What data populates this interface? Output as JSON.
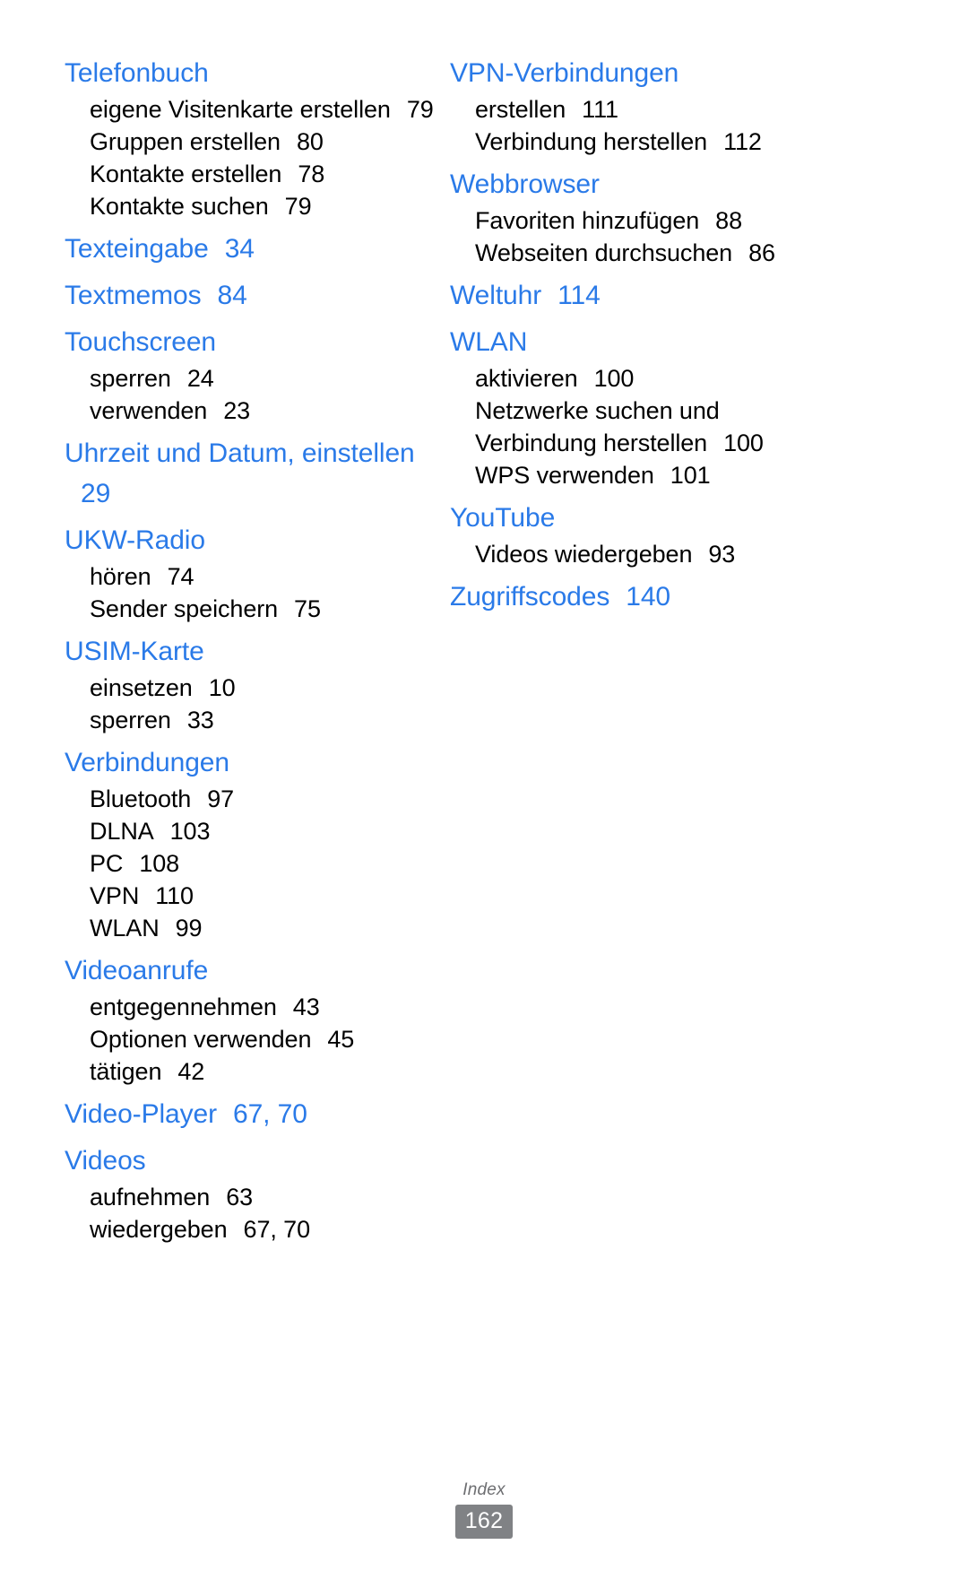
{
  "document": {
    "language": "de",
    "footer_label": "Index",
    "page_number": "162",
    "heading_color": "#2a7ae8",
    "body_color": "#000000",
    "badge_color": "#808285",
    "badge_text_color": "#ffffff"
  },
  "columns": [
    {
      "id": "left",
      "groups": [
        {
          "heading": "Telefonbuch",
          "heading_page": "",
          "subs": [
            {
              "label": "eigene Visitenkarte erstellen",
              "page": "79"
            },
            {
              "label": "Gruppen erstellen",
              "page": "80"
            },
            {
              "label": "Kontakte erstellen",
              "page": "78"
            },
            {
              "label": "Kontakte suchen",
              "page": "79"
            }
          ]
        },
        {
          "heading": "Texteingabe",
          "heading_page": "34",
          "subs": []
        },
        {
          "heading": "Textmemos",
          "heading_page": "84",
          "subs": []
        },
        {
          "heading": "Touchscreen",
          "heading_page": "",
          "subs": [
            {
              "label": "sperren",
              "page": "24"
            },
            {
              "label": "verwenden",
              "page": "23"
            }
          ]
        },
        {
          "heading": "Uhrzeit und Datum, einstellen",
          "heading_page": "29",
          "subs": []
        },
        {
          "heading": "UKW-Radio",
          "heading_page": "",
          "subs": [
            {
              "label": "hören",
              "page": "74"
            },
            {
              "label": "Sender speichern",
              "page": "75"
            }
          ]
        },
        {
          "heading": "USIM-Karte",
          "heading_page": "",
          "subs": [
            {
              "label": "einsetzen",
              "page": "10"
            },
            {
              "label": "sperren",
              "page": "33"
            }
          ]
        },
        {
          "heading": "Verbindungen",
          "heading_page": "",
          "subs": [
            {
              "label": "Bluetooth",
              "page": "97"
            },
            {
              "label": "DLNA",
              "page": "103"
            },
            {
              "label": "PC",
              "page": "108"
            },
            {
              "label": "VPN",
              "page": "110"
            },
            {
              "label": "WLAN",
              "page": "99"
            }
          ]
        },
        {
          "heading": "Videoanrufe",
          "heading_page": "",
          "subs": [
            {
              "label": "entgegennehmen",
              "page": "43"
            },
            {
              "label": "Optionen verwenden",
              "page": "45"
            },
            {
              "label": "tätigen",
              "page": "42"
            }
          ]
        },
        {
          "heading": "Video-Player",
          "heading_page": "67, 70",
          "subs": []
        },
        {
          "heading": "Videos",
          "heading_page": "",
          "subs": [
            {
              "label": "aufnehmen",
              "page": "63"
            },
            {
              "label": "wiedergeben",
              "page": "67, 70"
            }
          ]
        }
      ]
    },
    {
      "id": "right",
      "groups": [
        {
          "heading": "VPN-Verbindungen",
          "heading_page": "",
          "subs": [
            {
              "label": "erstellen",
              "page": "111"
            },
            {
              "label": "Verbindung herstellen",
              "page": "112"
            }
          ]
        },
        {
          "heading": "Webbrowser",
          "heading_page": "",
          "subs": [
            {
              "label": "Favoriten hinzufügen",
              "page": "88"
            },
            {
              "label": "Webseiten durchsuchen",
              "page": "86"
            }
          ]
        },
        {
          "heading": "Weltuhr",
          "heading_page": "114",
          "subs": []
        },
        {
          "heading": "WLAN",
          "heading_page": "",
          "subs": [
            {
              "label": "aktivieren",
              "page": "100"
            },
            {
              "label": "Netzwerke suchen und Verbindung herstellen",
              "page": "100"
            },
            {
              "label": "WPS verwenden",
              "page": "101"
            }
          ]
        },
        {
          "heading": "YouTube",
          "heading_page": "",
          "subs": [
            {
              "label": "Videos wiedergeben",
              "page": "93"
            }
          ]
        },
        {
          "heading": "Zugriffscodes",
          "heading_page": "140",
          "subs": []
        }
      ]
    }
  ]
}
